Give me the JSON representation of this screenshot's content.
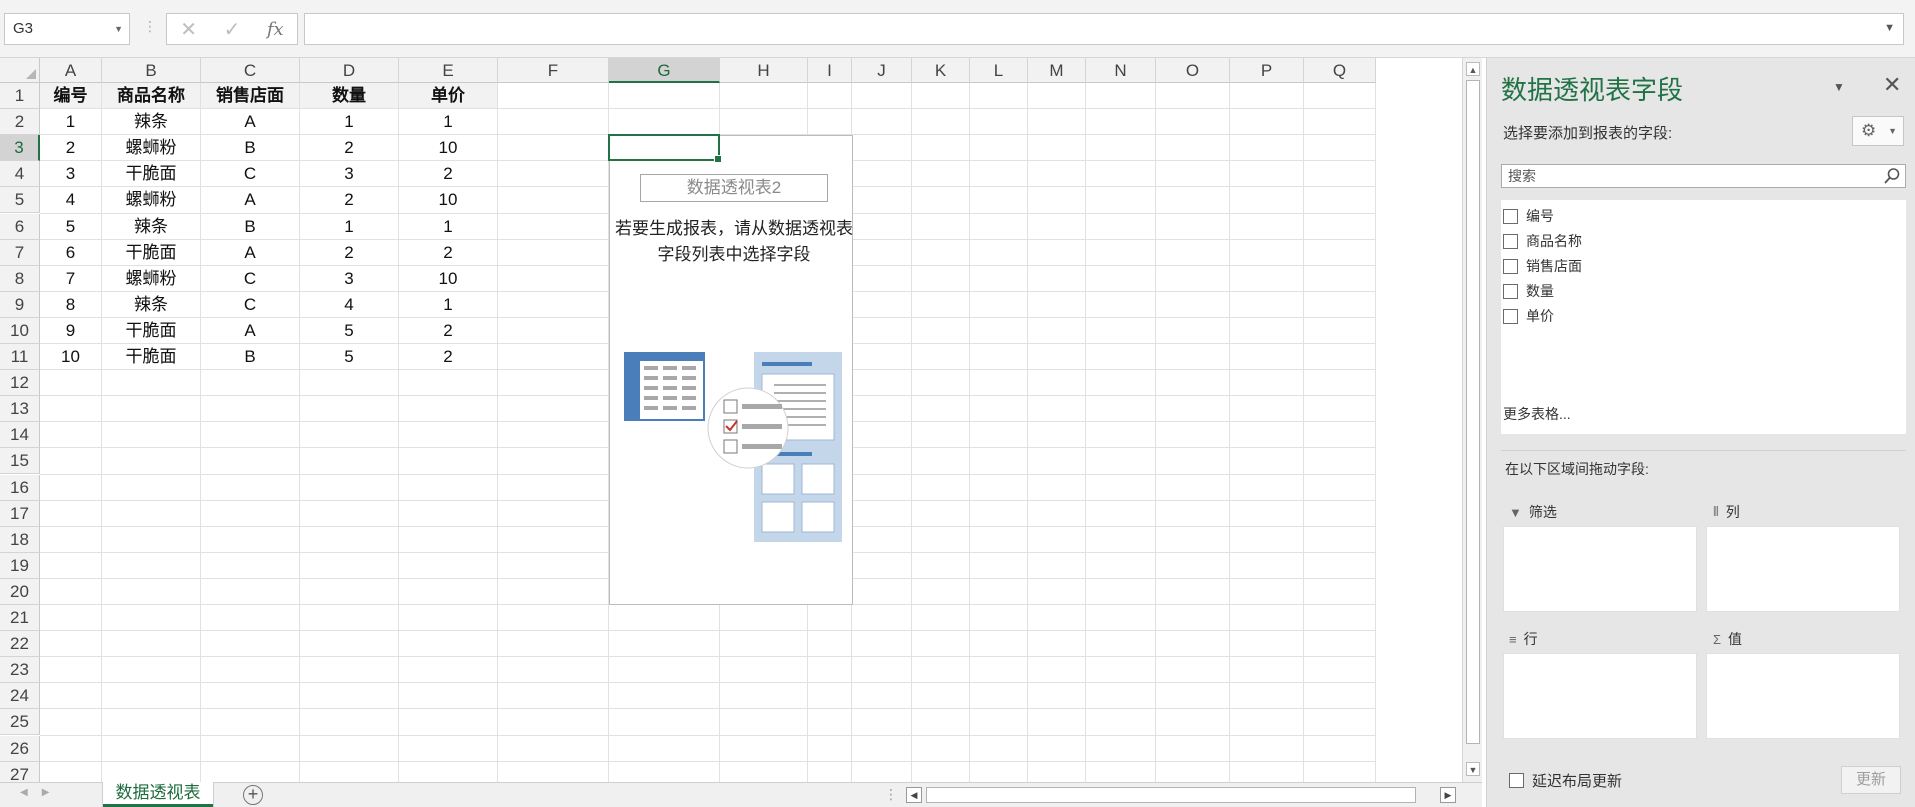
{
  "formula_bar": {
    "name_box": "G3",
    "cancel_icon": "✕",
    "enter_icon": "✓",
    "fx_label": "fx",
    "formula": ""
  },
  "sheet": {
    "columns": [
      "A",
      "B",
      "C",
      "D",
      "E",
      "F",
      "G",
      "H",
      "I",
      "J",
      "K",
      "L",
      "M",
      "N",
      "O",
      "P",
      "Q"
    ],
    "rows": [
      "1",
      "2",
      "3",
      "4",
      "5",
      "6",
      "7",
      "8",
      "9",
      "10",
      "11",
      "12",
      "13",
      "14",
      "15",
      "16",
      "17",
      "18",
      "19",
      "20",
      "21",
      "22",
      "23",
      "24",
      "25",
      "26",
      "27"
    ],
    "selected_cell": "G3",
    "header": [
      "编号",
      "商品名称",
      "销售店面",
      "数量",
      "单价"
    ],
    "data": [
      [
        "1",
        "辣条",
        "A",
        "1",
        "1"
      ],
      [
        "2",
        "螺蛳粉",
        "B",
        "2",
        "10"
      ],
      [
        "3",
        "干脆面",
        "C",
        "3",
        "2"
      ],
      [
        "4",
        "螺蛳粉",
        "A",
        "2",
        "10"
      ],
      [
        "5",
        "辣条",
        "B",
        "1",
        "1"
      ],
      [
        "6",
        "干脆面",
        "A",
        "2",
        "2"
      ],
      [
        "7",
        "螺蛳粉",
        "C",
        "3",
        "10"
      ],
      [
        "8",
        "辣条",
        "C",
        "4",
        "1"
      ],
      [
        "9",
        "干脆面",
        "A",
        "5",
        "2"
      ],
      [
        "10",
        "干脆面",
        "B",
        "5",
        "2"
      ]
    ]
  },
  "pivot_placeholder": {
    "name": "数据透视表2",
    "message": "若要生成报表，请从数据透视表字段列表中选择字段"
  },
  "tabs": {
    "sheets": [
      "数据透视表"
    ],
    "active": "数据透视表",
    "add_icon": "+"
  },
  "pane": {
    "title": "数据透视表字段",
    "subtitle": "选择要添加到报表的字段:",
    "search_placeholder": "搜索",
    "fields": [
      "编号",
      "商品名称",
      "销售店面",
      "数量",
      "单价"
    ],
    "more_tables": "更多表格...",
    "drag_label": "在以下区域间拖动字段:",
    "areas": {
      "filter": "筛选",
      "columns": "列",
      "rows": "行",
      "values": "值"
    },
    "defer_label": "延迟布局更新",
    "update_button": "更新"
  },
  "colors": {
    "accent": "#217346",
    "header_bg": "#f2f2f2",
    "pane_bg": "#e6e6e6"
  }
}
